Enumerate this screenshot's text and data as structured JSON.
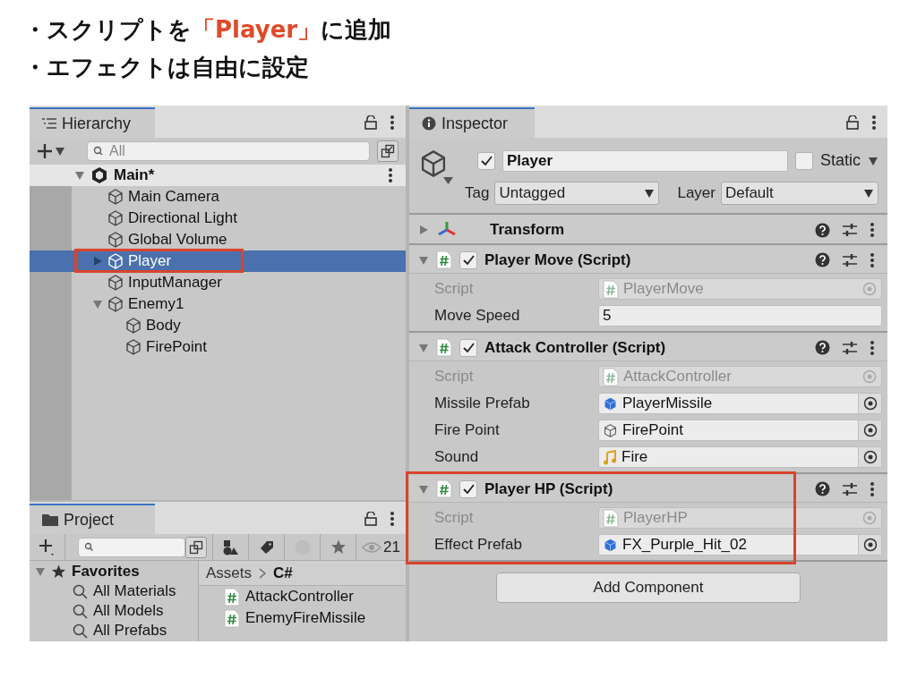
{
  "slide_bullets": [
    {
      "parts": [
        {
          "text": "・スクリプトを",
          "emphasis": false
        },
        {
          "text": "「Player」",
          "emphasis": true
        },
        {
          "text": "に追加",
          "emphasis": false
        }
      ]
    },
    {
      "parts": [
        {
          "text": "・エフェクトは自由に設定",
          "emphasis": false
        }
      ]
    }
  ],
  "hierarchy": {
    "tab": "Hierarchy",
    "search_placeholder": "All",
    "scene": {
      "name": "Main*",
      "expanded": true
    },
    "items": [
      {
        "label": "Main Camera",
        "selected": false,
        "highlight": false
      },
      {
        "label": "Directional Light",
        "selected": false,
        "highlight": false
      },
      {
        "label": "Global Volume",
        "selected": false,
        "highlight": false
      },
      {
        "label": "Player",
        "selected": true,
        "highlight": true,
        "expanded": false
      },
      {
        "label": "InputManager",
        "selected": false,
        "highlight": false
      },
      {
        "label": "Enemy1",
        "selected": false,
        "highlight": false,
        "expanded": true,
        "children": [
          {
            "label": "Body",
            "selected": false,
            "highlight": false
          },
          {
            "label": "FirePoint",
            "selected": false,
            "highlight": false
          }
        ]
      }
    ]
  },
  "project": {
    "tab": "Project",
    "visible_count": "21",
    "favorites": {
      "label": "Favorites",
      "expanded": true,
      "items": [
        "All Materials",
        "All Models",
        "All Prefabs"
      ]
    },
    "breadcrumb": [
      "Assets",
      "C#"
    ],
    "assets": [
      "AttackController",
      "EnemyFireMissile"
    ]
  },
  "inspector": {
    "tab": "Inspector",
    "object": {
      "active": true,
      "name": "Player",
      "static": false,
      "tag_label": "Tag",
      "tag": "Untagged",
      "layer_label": "Layer",
      "layer": "Default",
      "static_label": "Static"
    },
    "components": [
      {
        "kind": "transform",
        "title": "Transform",
        "expanded": false,
        "highlight": false
      },
      {
        "kind": "script",
        "title": "Player Move (Script)",
        "enabled": true,
        "expanded": true,
        "highlight": false,
        "fields": [
          {
            "label": "Script",
            "value": "PlayerMove",
            "kind": "script"
          },
          {
            "label": "Move Speed",
            "value": "5",
            "kind": "number"
          }
        ]
      },
      {
        "kind": "script",
        "title": "Attack Controller (Script)",
        "enabled": true,
        "expanded": true,
        "highlight": false,
        "fields": [
          {
            "label": "Script",
            "value": "AttackController",
            "kind": "script"
          },
          {
            "label": "Missile Prefab",
            "value": "PlayerMissile",
            "kind": "prefab"
          },
          {
            "label": "Fire Point",
            "value": "FirePoint",
            "kind": "gameobject"
          },
          {
            "label": "Sound",
            "value": "Fire",
            "kind": "audio"
          }
        ]
      },
      {
        "kind": "script",
        "title": "Player HP (Script)",
        "enabled": true,
        "expanded": true,
        "highlight": true,
        "fields": [
          {
            "label": "Script",
            "value": "PlayerHP",
            "kind": "script"
          },
          {
            "label": "Effect Prefab",
            "value": "FX_Purple_Hit_02",
            "kind": "prefab"
          }
        ]
      }
    ],
    "add_button": "Add Component"
  }
}
